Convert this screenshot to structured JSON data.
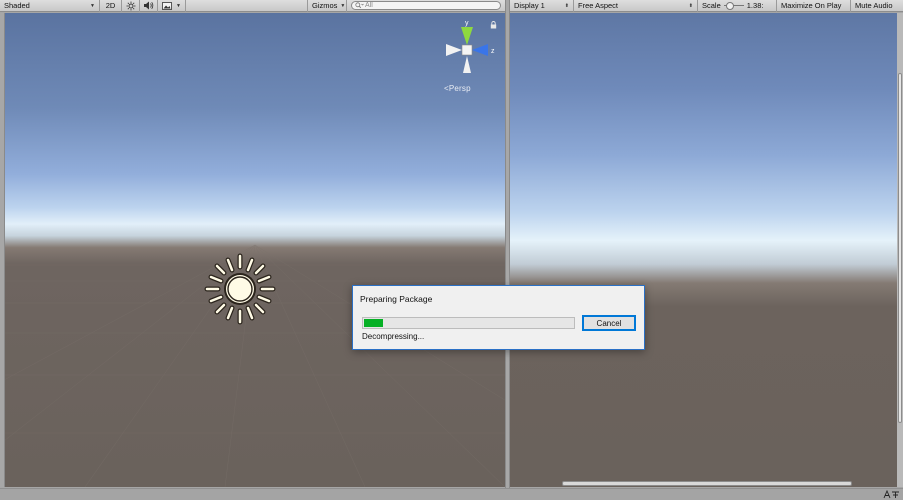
{
  "scene_toolbar": {
    "shading_mode": "Shaded",
    "mode_2d": "2D",
    "gizmos_label": "Gizmos",
    "search_placeholder": "All"
  },
  "game_toolbar": {
    "display": "Display 1",
    "aspect": "Free Aspect",
    "scale_label": "Scale",
    "scale_value": "1.38:",
    "maximize_on_play": "Maximize On Play",
    "mute_audio": "Mute Audio"
  },
  "gizmo": {
    "y_label": "y",
    "z_label": "z",
    "projection_label": "Persp"
  },
  "dialog": {
    "title": "Preparing Package",
    "cancel_label": "Cancel",
    "status_text": "Decompressing...",
    "progress_fraction": 0.1
  },
  "colors": {
    "progress_fill": "#06b025",
    "dialog_border": "#2a70c6",
    "gizmo_y": "#8ed93f",
    "gizmo_z": "#3a75e8"
  },
  "icons": [
    "sun-toggle-icon",
    "audio-icon",
    "effects-icon",
    "lock-icon",
    "sun-light-icon",
    "orientation-gizmo"
  ]
}
